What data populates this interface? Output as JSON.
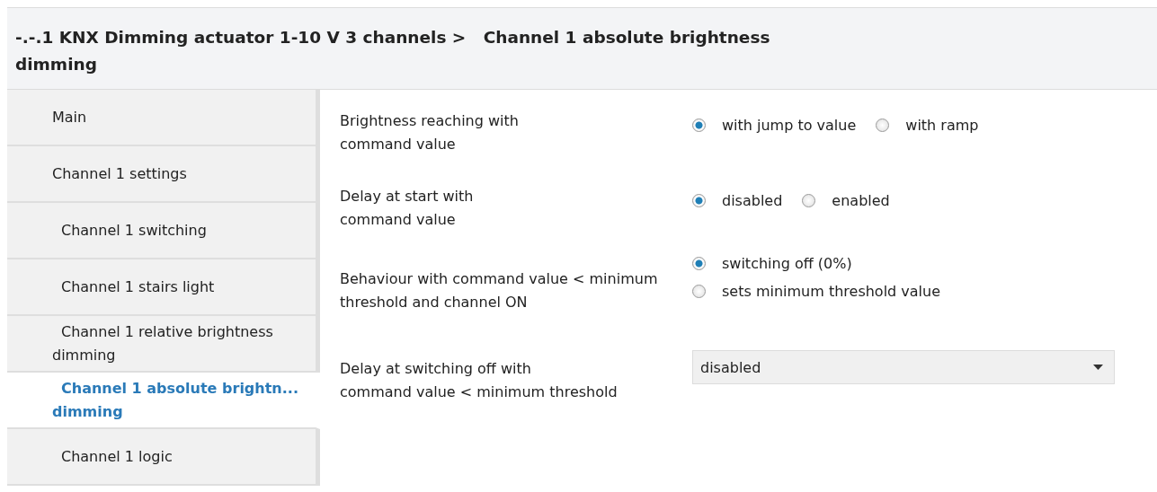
{
  "header": {
    "title": "-.-.1 KNX Dimming actuator 1-10 V 3 channels >   Channel 1 absolute brightness\ndimming"
  },
  "sidebar": {
    "items": [
      {
        "label": "Main",
        "selected": false
      },
      {
        "label": "Channel 1 settings",
        "selected": false,
        "children": [
          {
            "label": "Channel 1 switching",
            "selected": false
          },
          {
            "label": "Channel 1 stairs light",
            "selected": false
          },
          {
            "label": "Channel 1 relative brightness\ndimming",
            "selected": false
          },
          {
            "label": "Channel 1 absolute brightn...\ndimming",
            "selected": true
          },
          {
            "label": "Channel 1 logic",
            "selected": false
          }
        ]
      }
    ]
  },
  "parameters": [
    {
      "label": "Brightness reaching with\ncommand value",
      "kind": "radio-inline",
      "options": [
        {
          "label": "with jump to value",
          "selected": true
        },
        {
          "label": "with ramp",
          "selected": false
        }
      ]
    },
    {
      "label": "Delay at start with\ncommand value",
      "kind": "radio-inline",
      "options": [
        {
          "label": "disabled",
          "selected": true
        },
        {
          "label": "enabled",
          "selected": false
        }
      ]
    },
    {
      "label": "Behaviour with command value < minimum\nthreshold and channel ON",
      "kind": "radio-stacked",
      "options": [
        {
          "label": "switching off (0%)",
          "selected": true
        },
        {
          "label": "sets minimum threshold value",
          "selected": false
        }
      ]
    },
    {
      "label": "Delay at switching off with\ncommand value < minimum threshold",
      "kind": "dropdown",
      "value": "disabled"
    }
  ]
}
